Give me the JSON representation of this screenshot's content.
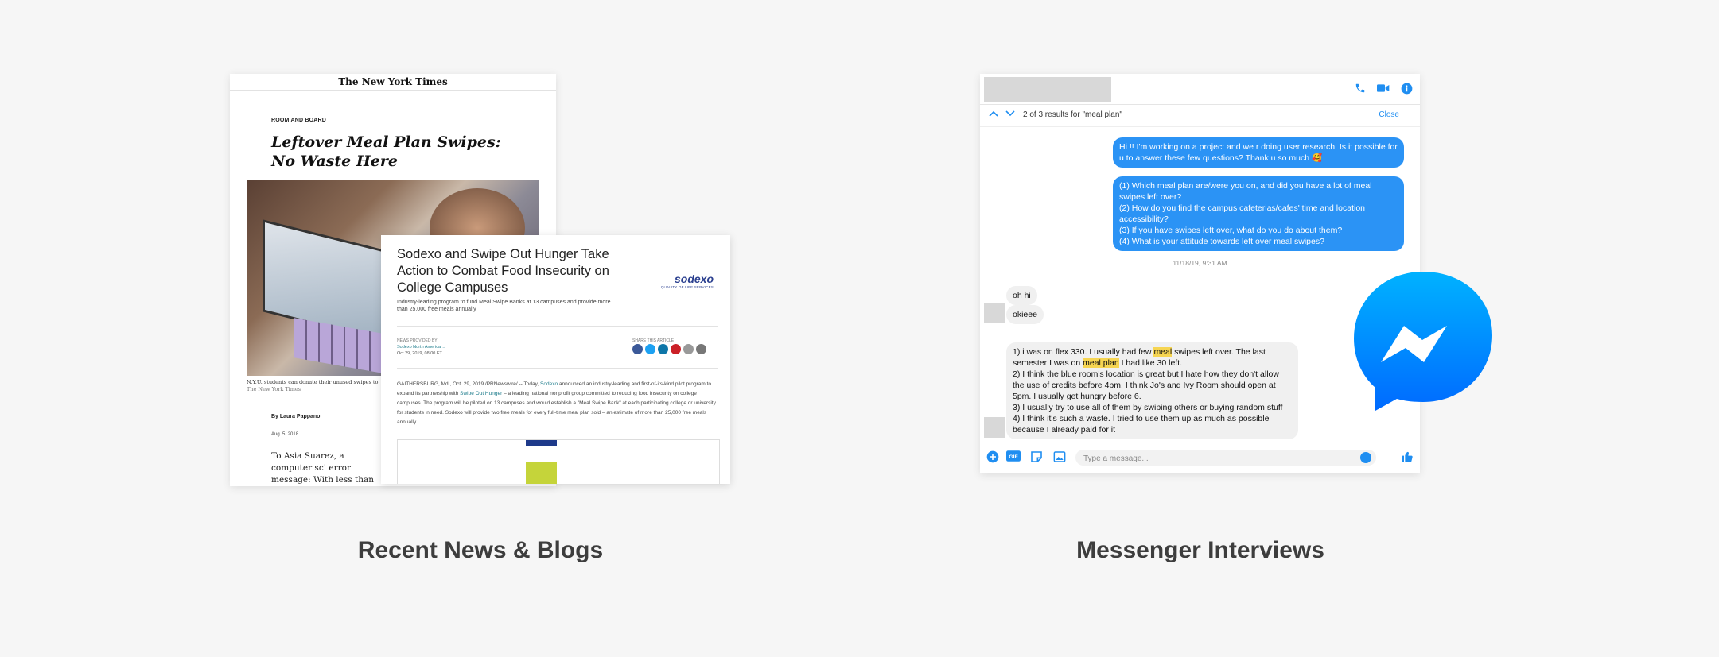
{
  "nyt": {
    "masthead": "The New York Times",
    "kicker": "ROOM AND BOARD",
    "headline": "Leftover Meal Plan Swipes: No Waste Here",
    "photo_caption": "N.Y.U. students can donate their unused swipes to",
    "photo_credit": "The New York Times",
    "byline": "By Laura Pappano",
    "date": "Aug. 5, 2018",
    "body": "To Asia Suarez, a computer sci error message: With less than she would need to eat seven meals a day to use up the remaining"
  },
  "sodexo": {
    "title": "Sodexo and Swipe Out Hunger Take Action to Combat Food Insecurity on College Campuses",
    "subtitle": "Industry-leading program to fund Meal Swipe Banks at 13 campuses and provide more than 25,000 free meals annually",
    "logo_name": "sodexo",
    "logo_tagline": "QUALITY OF LIFE SERVICES",
    "provided_label": "NEWS PROVIDED BY",
    "provider": "Sodexo North America →",
    "published": "Oct 29, 2019, 08:00 ET",
    "share_label": "SHARE THIS ARTICLE",
    "share_colors": [
      "#3b5998",
      "#1da1f2",
      "#0e76a8",
      "#cb2027",
      "#999999",
      "#777777"
    ],
    "body_parts": {
      "p1": "GAITHERSBURG, Md., Oct. 29, 2019 /PRNewswire/ -- Today, ",
      "link1": "Sodexo",
      "p2": " announced an industry-leading and first-of-its-kind pilot program to expand its partnership with ",
      "link2": "Swipe Out Hunger",
      "p3": " – a leading national nonprofit group committed to reducing food insecurity on college campuses. The program will be piloted on 13 campuses and would establish a \"Meal Swipe Bank\" at each participating college or university for students in need. Sodexo will provide two free meals for every full-time meal plan sold – an estimate of more than 25,000 free meals annually."
    }
  },
  "messenger": {
    "search": {
      "up_icon": "chevron-up-icon",
      "down_icon": "chevron-down-icon",
      "result_count": "2 of 3 results for \"meal plan\"",
      "close_label": "Close"
    },
    "header_icons": [
      "phone-icon",
      "video-icon",
      "info-icon"
    ],
    "messages": {
      "out1": "Hi                  !! I'm working on a project and we r doing user research. Is it possible for u to answer these few questions? Thank u so much 🥰",
      "out2": [
        "(1) Which meal plan are/were you on, and did you have a lot of meal swipes left over?",
        "(2) How do you find the campus cafeterias/cafes' time and location accessibility?",
        "(3) If you have swipes left over, what do you do about them?",
        "(4) What is your attitude towards left over meal swipes?"
      ],
      "timestamp": "11/18/19, 9:31 AM",
      "in1": "oh hi",
      "in2": "okieee",
      "in3": {
        "a": "1) i was on flex 330. I usually had few ",
        "hl1": "meal",
        "b": " swipes left over. The last semester I was on ",
        "hl2": "meal plan",
        "c": " I had like 30 left.",
        "lines": [
          "2) I think the blue room's location is great but I hate how they don't allow the use of credits before 4pm. I think Jo's and Ivy Room should open at 5pm. I usually get hungry before 6.",
          "3) I usually try to use all of them by swiping others or buying random stuff",
          "4) I think it's such a waste. I tried to use them up as much as possible because I already paid for it"
        ]
      }
    },
    "footer": {
      "icons": [
        "plus-icon",
        "gif-icon",
        "sticker-icon",
        "image-icon"
      ],
      "placeholder": "Type a message...",
      "emoji_icon": "emoji-icon",
      "like_icon": "thumbs-up-icon"
    }
  },
  "captions": {
    "left": "Recent News & Blogs",
    "right": "Messenger Interviews"
  },
  "colors": {
    "messenger_blue": "#2b93f5",
    "highlight": "#f6d552"
  }
}
